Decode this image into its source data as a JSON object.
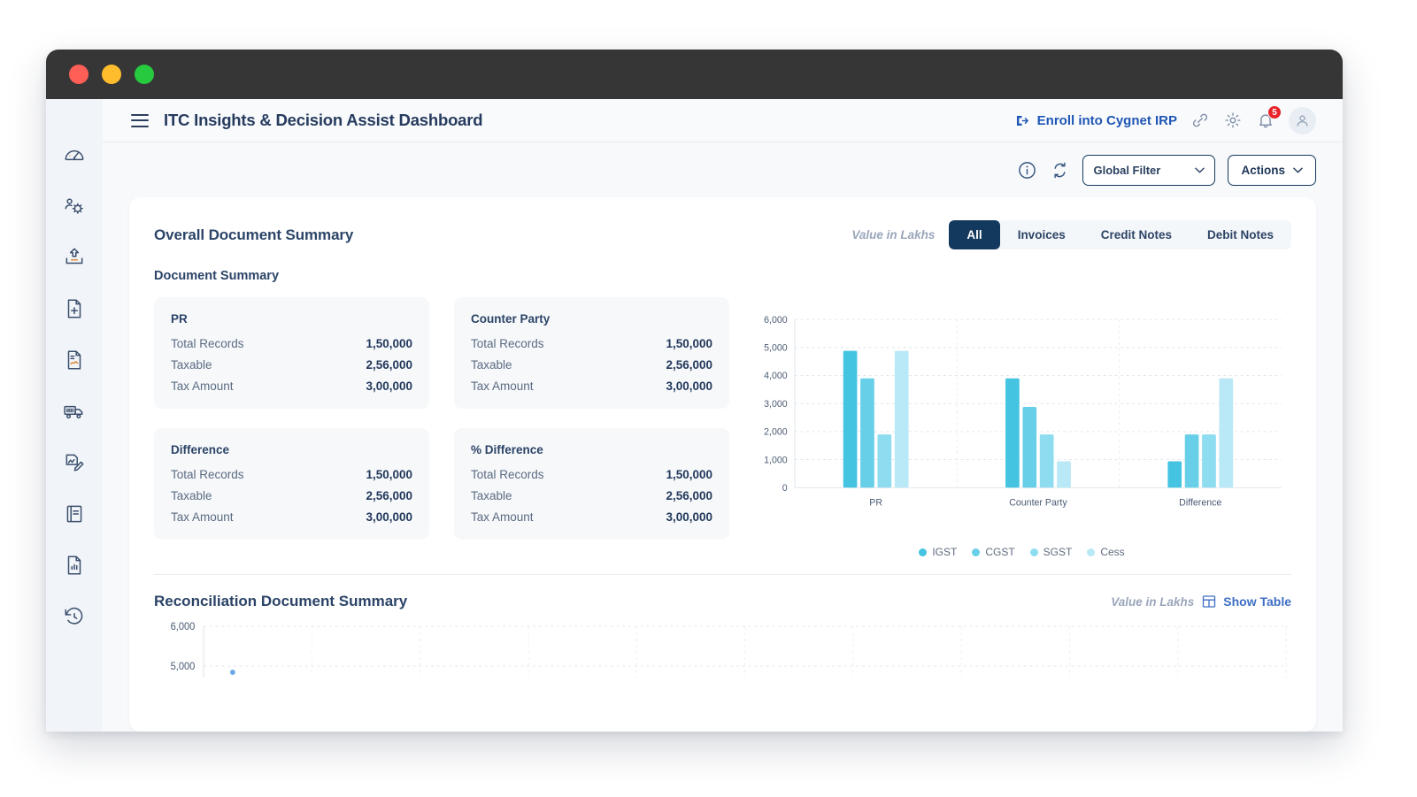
{
  "window": {
    "controls": [
      "close",
      "minimize",
      "maximize"
    ]
  },
  "header": {
    "title": "ITC Insights & Decision Assist Dashboard",
    "enroll_label": "Enroll into Cygnet IRP",
    "notification_count": "5"
  },
  "toolbar": {
    "filter_label": "Global Filter",
    "actions_label": "Actions"
  },
  "sidebar": {
    "items": [
      {
        "name": "dashboard-gauge"
      },
      {
        "name": "user-settings"
      },
      {
        "name": "upload"
      },
      {
        "name": "document-add"
      },
      {
        "name": "document-signed"
      },
      {
        "name": "truck-delivery"
      },
      {
        "name": "document-edit"
      },
      {
        "name": "book"
      },
      {
        "name": "document-report"
      },
      {
        "name": "history"
      }
    ]
  },
  "overall": {
    "title": "Overall Document Summary",
    "value_note": "Value in Lakhs",
    "tabs": [
      {
        "label": "All",
        "active": true
      },
      {
        "label": "Invoices",
        "active": false
      },
      {
        "label": "Credit Notes",
        "active": false
      },
      {
        "label": "Debit Notes",
        "active": false
      }
    ],
    "section_title": "Document Summary",
    "cards": [
      {
        "title": "PR",
        "rows": [
          {
            "label": "Total Records",
            "value": "1,50,000"
          },
          {
            "label": "Taxable",
            "value": "2,56,000"
          },
          {
            "label": "Tax Amount",
            "value": "3,00,000"
          }
        ]
      },
      {
        "title": "Counter Party",
        "rows": [
          {
            "label": "Total Records",
            "value": "1,50,000"
          },
          {
            "label": "Taxable",
            "value": "2,56,000"
          },
          {
            "label": "Tax Amount",
            "value": "3,00,000"
          }
        ]
      },
      {
        "title": "Difference",
        "rows": [
          {
            "label": "Total Records",
            "value": "1,50,000"
          },
          {
            "label": "Taxable",
            "value": "2,56,000"
          },
          {
            "label": "Tax Amount",
            "value": "3,00,000"
          }
        ]
      },
      {
        "title": "% Difference",
        "rows": [
          {
            "label": "Total Records",
            "value": "1,50,000"
          },
          {
            "label": "Taxable",
            "value": "2,56,000"
          },
          {
            "label": "Tax Amount",
            "value": "3,00,000"
          }
        ]
      }
    ]
  },
  "reconciliation": {
    "title": "Reconciliation Document Summary",
    "value_note": "Value in Lakhs",
    "show_table_label": "Show Table",
    "chart_data": {
      "type": "line",
      "title": "Reconciliation Document Summary",
      "yticks": [
        "6,000",
        "5,000"
      ],
      "ylim": [
        0,
        6000
      ],
      "grid": true,
      "x": [],
      "series": []
    }
  },
  "chart_data": {
    "type": "bar",
    "title": "Overall Document Summary",
    "xlabel": "",
    "ylabel": "",
    "categories": [
      "PR",
      "Counter Party",
      "Difference"
    ],
    "yticks": [
      0,
      1000,
      2000,
      3000,
      4000,
      5000,
      6000
    ],
    "yticklabels": [
      "0",
      "1,000",
      "2,000",
      "3,000",
      "4,000",
      "5,000",
      "6,000"
    ],
    "ylim": [
      0,
      6000
    ],
    "grid": true,
    "legend_position": "bottom",
    "series": [
      {
        "name": "IGST",
        "color": "#45c4e2",
        "values": [
          4880,
          3900,
          940
        ]
      },
      {
        "name": "CGST",
        "color": "#68cfe8",
        "values": [
          3900,
          2880,
          1900
        ]
      },
      {
        "name": "SGST",
        "color": "#8edcf0",
        "values": [
          1900,
          1900,
          1900
        ]
      },
      {
        "name": "Cess",
        "color": "#b9e8f6",
        "values": [
          4880,
          940,
          3900
        ]
      }
    ]
  },
  "colors": {
    "accent_navy": "#14395f",
    "link_blue": "#1f56b5",
    "badge_red": "#e8242a",
    "card_bg": "#f6f8fa"
  }
}
